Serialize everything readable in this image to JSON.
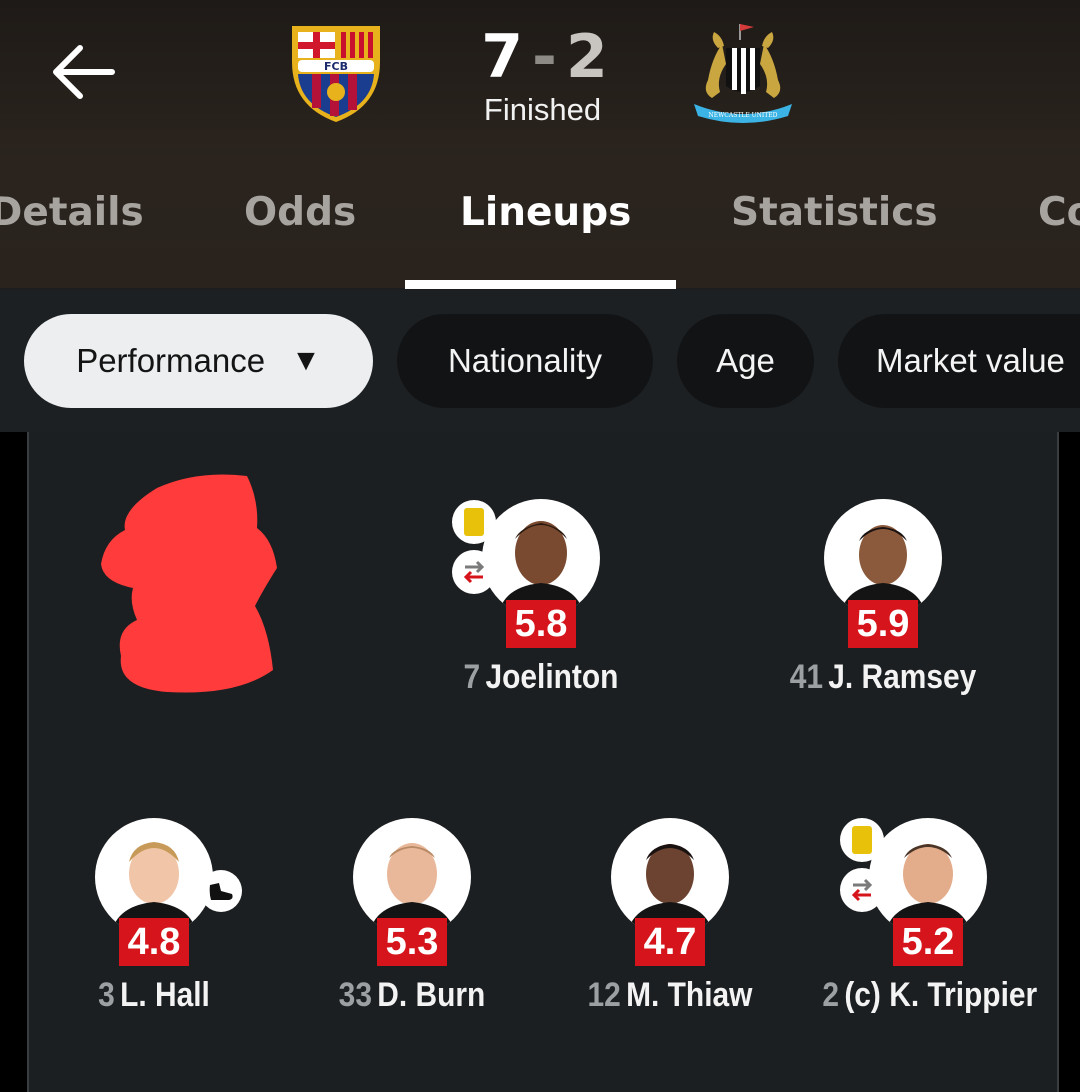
{
  "match": {
    "home_team": "Barcelona",
    "away_team": "Newcastle United",
    "home_crest_text": "FCB",
    "away_crest_text": "NEWCASTLE UNITED",
    "home_score": "7",
    "score_separator": "-",
    "away_score": "2",
    "status": "Finished"
  },
  "tabs": [
    {
      "label": "Details",
      "active": false
    },
    {
      "label": "Odds",
      "active": false
    },
    {
      "label": "Lineups",
      "active": true
    },
    {
      "label": "Statistics",
      "active": false
    },
    {
      "label": "Co",
      "active": false
    }
  ],
  "filters": [
    {
      "label": "Performance",
      "active": true,
      "dropdown": true
    },
    {
      "label": "Nationality",
      "active": false
    },
    {
      "label": "Age",
      "active": false
    },
    {
      "label": "Market value",
      "active": false
    }
  ],
  "players": [
    {
      "number": "7",
      "name": "Joelinton",
      "rating": "5.8",
      "yellow_card": true,
      "substituted": true
    },
    {
      "number": "41",
      "name": "J. Ramsey",
      "rating": "5.9"
    },
    {
      "number": "3",
      "name": "L. Hall",
      "rating": "4.8",
      "assist_icon": "boot-icon"
    },
    {
      "number": "33",
      "name": "D. Burn",
      "rating": "5.3"
    },
    {
      "number": "12",
      "name": "M. Thiaw",
      "rating": "4.7"
    },
    {
      "number": "2",
      "name": "(c) K. Trippier",
      "rating": "5.2",
      "yellow_card": true,
      "substituted": true
    }
  ],
  "colors": {
    "rating_red": "#d6141b",
    "yellow_card": "#e8c20a",
    "redaction": "#ff3b3b",
    "active_tab_underline": "#ffffff"
  }
}
